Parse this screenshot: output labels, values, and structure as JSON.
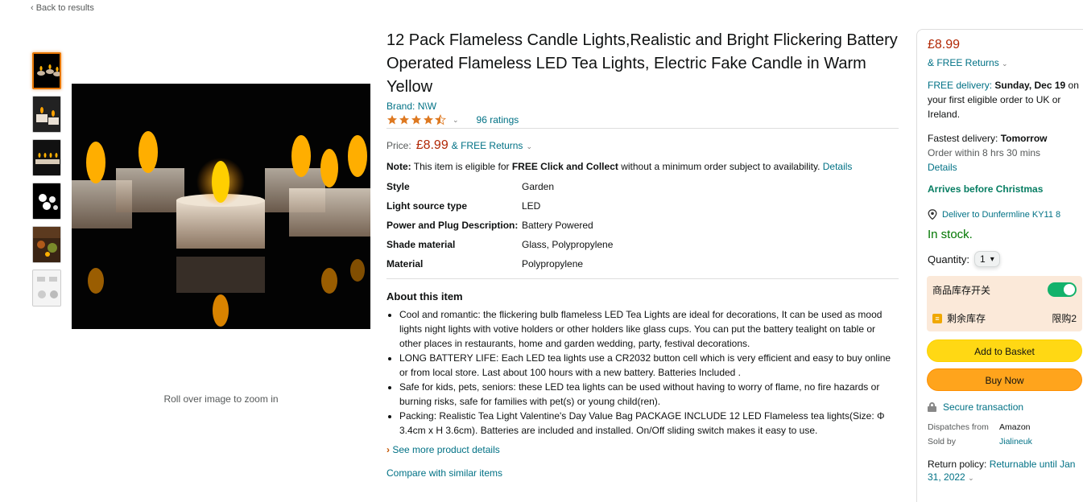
{
  "nav": {
    "back": "‹ Back to results"
  },
  "gallery": {
    "thumbnails": [
      "thumb-1",
      "thumb-2",
      "thumb-3",
      "thumb-4",
      "thumb-5",
      "thumb-6"
    ],
    "zoom_hint": "Roll over image to zoom in"
  },
  "product": {
    "title": "12 Pack Flameless Candle Lights,Realistic and Bright Flickering Battery Operated Flameless LED Tea Lights, Electric Fake Candle in Warm Yellow",
    "brand": "Brand: N\\W",
    "rating": 4.5,
    "ratings_count": "96 ratings",
    "price_label": "Price:",
    "price": "£8.99",
    "returns": "& FREE Returns",
    "note_label": "Note:",
    "note_text_1": " This item is eligible for ",
    "note_bold": "FREE Click and Collect",
    "note_text_2": " without a minimum order subject to availability. ",
    "note_link": "Details",
    "specs": [
      {
        "key": "Style",
        "value": "Garden"
      },
      {
        "key": "Light source type",
        "value": "LED"
      },
      {
        "key": "Power and Plug Description:",
        "value": "Battery Powered"
      },
      {
        "key": "Shade material",
        "value": "Glass, Polypropylene"
      },
      {
        "key": "Material",
        "value": "Polypropylene"
      }
    ],
    "about_heading": "About this item",
    "bullets": [
      "Cool and romantic: the flickering bulb flameless LED Tea Lights are ideal for decorations, It can be used as mood lights night lights with votive holders or other holders like glass cups. You can put the battery tealight on table or other places in restaurants, home and garden wedding, party, festival decorations.",
      "LONG BATTERY LIFE: Each LED tea lights use a CR2032 button cell which is very efficient and easy to buy online or from local store. Last about 100 hours with a new battery. Batteries Included .",
      "Safe for kids, pets, seniors: these LED tea lights can be used without having to worry of flame, no fire hazards or burning risks, safe for families with pet(s) or young child(ren).",
      "Packing: Realistic Tea Light Valentine's Day Value Bag PACKAGE INCLUDE 12 LED Flameless tea lights(Size: Φ 3.4cm x H 3.6cm). Batteries are included and installed. On/Off sliding switch makes it easy to use."
    ],
    "see_more": "See more product details",
    "compare": "Compare with similar items"
  },
  "buybox": {
    "price": "£8.99",
    "returns": "& FREE Returns",
    "free_delivery_link": "FREE delivery:",
    "free_delivery_date": " Sunday, Dec 19",
    "free_delivery_rest": " on your first eligible order to UK or Ireland.",
    "fastest_label": "Fastest delivery: ",
    "fastest_value": "Tomorrow",
    "order_within": "Order within 8 hrs 30 mins",
    "details": "Details",
    "arrives": "Arrives before Christmas",
    "deliver_to": "Deliver to Dunfermline KY11 8",
    "stock": "In stock.",
    "quantity_label": "Quantity:",
    "quantity_value": "1",
    "stock_switch_label": "商品库存开关",
    "remaining_label": "剩余库存",
    "limit_label": "限购2",
    "add_to_basket": "Add to Basket",
    "buy_now": "Buy Now",
    "secure": "Secure transaction",
    "dispatches_label": "Dispatches from",
    "dispatches_value": "Amazon",
    "sold_by_label": "Sold by",
    "sold_by_value": "Jialineuk",
    "return_label": "Return policy: ",
    "return_value": "Returnable until Jan 31, 2022"
  }
}
